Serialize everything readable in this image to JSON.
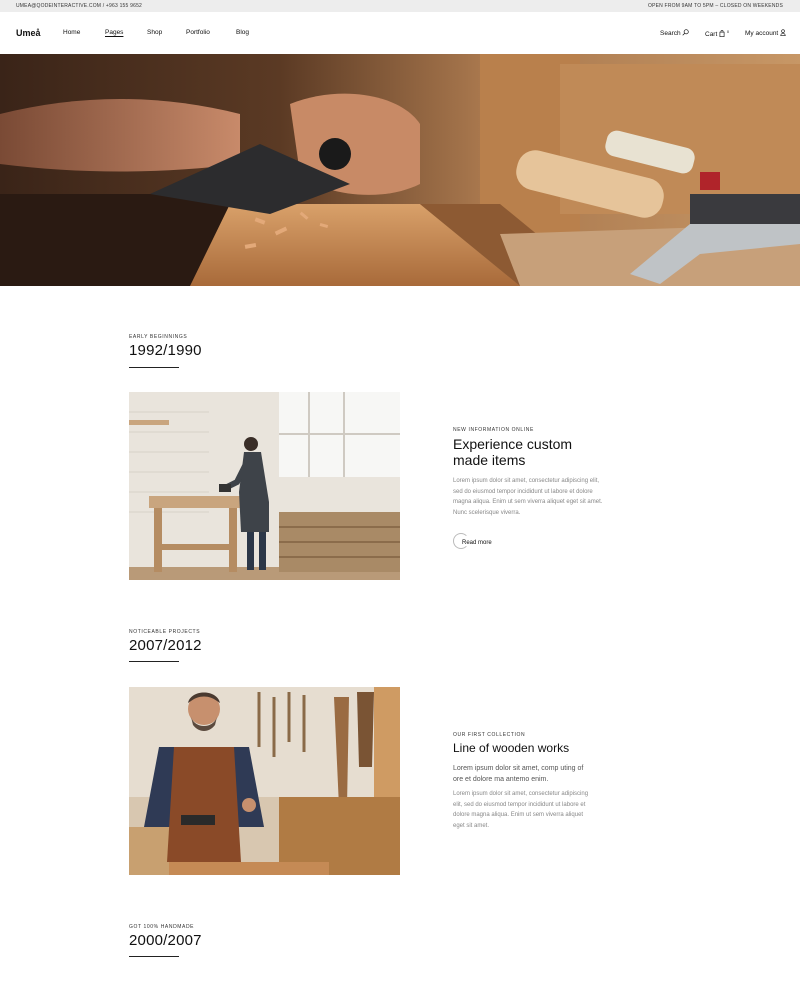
{
  "topbar": {
    "contact": "UMEA@QODEINTERACTIVE.COM / +963 155 9652",
    "hours": "OPEN FROM 9AM TO 5PM – CLOSED ON WEEKENDS"
  },
  "nav": {
    "logo": "Umeå",
    "items": [
      "Home",
      "Pages",
      "Shop",
      "Portfolio",
      "Blog"
    ],
    "active": "Pages",
    "search_label": "Search",
    "cart_label": "Cart",
    "cart_count": "0",
    "account_label": "My account"
  },
  "sections": [
    {
      "eyebrow": "EARLY BEGINNINGS",
      "years": "1992/1990"
    },
    {
      "eyebrow": "NOTICEABLE PROJECTS",
      "years": "2007/2012"
    },
    {
      "eyebrow": "GOT 100% HANDMADE",
      "years": "2000/2007"
    }
  ],
  "card1": {
    "eyebrow": "NEW INFORMATION ONLINE",
    "title": "Experience custom made items",
    "body": "Lorem ipsum dolor sit amet, consectetur adipiscing elit, sed do eiusmod tempor incididunt ut labore et dolore magna aliqua. Enim ut sem viverra aliquet eget sit amet. Nunc scelerisque viverra.",
    "button": "Read more"
  },
  "card2": {
    "eyebrow": "OUR FIRST COLLECTION",
    "title": "Line of wooden works",
    "lead": "Lorem ipsum dolor sit amet, comp uting of ore et dolore ma antemo enim.",
    "body": "Lorem ipsum dolor sit amet, consectetur adipiscing elit, sed do eiusmod tempor incididunt ut labore et dolore magna aliqua. Enim ut sem viverra aliquet eget sit amet."
  },
  "colors": {
    "topbar_bg": "#ededed",
    "text": "#111111",
    "muted": "#888888"
  }
}
